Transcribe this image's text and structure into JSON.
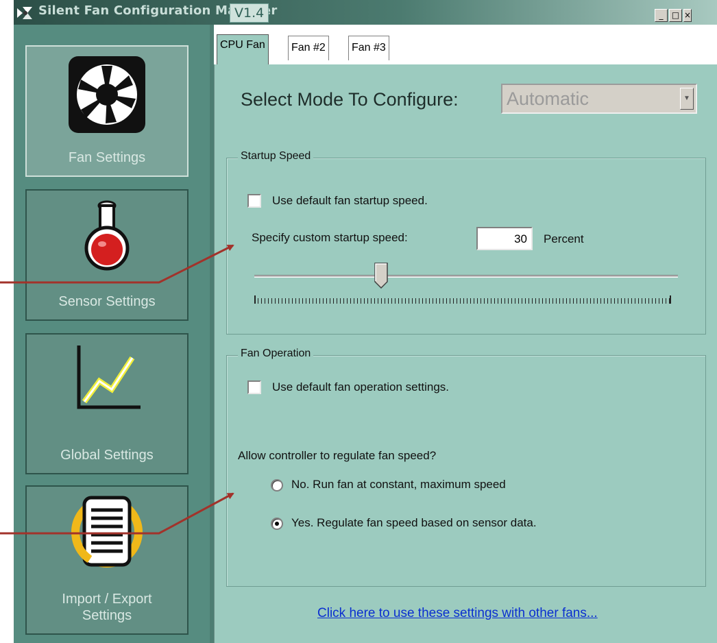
{
  "window": {
    "title": "Silent Fan Configuration Manager",
    "version": "V1.4",
    "minimize": "_",
    "maximize": "□",
    "close": "×"
  },
  "sidebar": {
    "items": [
      {
        "label": "Fan Settings",
        "icon": "fan-icon",
        "active": true
      },
      {
        "label": "Sensor Settings",
        "icon": "flask-icon",
        "active": false
      },
      {
        "label": "Global Settings",
        "icon": "line-chart-icon",
        "active": false
      },
      {
        "label": "Import / Export",
        "label2": "Settings",
        "icon": "document-sync-icon",
        "active": false
      }
    ]
  },
  "tabs": [
    {
      "label": "CPU Fan",
      "active": true
    },
    {
      "label": "Fan #2",
      "active": false
    },
    {
      "label": "Fan #3",
      "active": false
    }
  ],
  "mode": {
    "label": "Select Mode To Configure:",
    "value": "Automatic"
  },
  "startup": {
    "legend": "Startup Speed",
    "default_checkbox_label": "Use default fan startup speed.",
    "default_checked": false,
    "custom_label": "Specify custom startup speed:",
    "value": "30",
    "unit": "Percent",
    "slider_percent": 30
  },
  "operation": {
    "legend": "Fan Operation",
    "default_checkbox_label": "Use default fan operation settings.",
    "default_checked": false,
    "question": "Allow controller to regulate fan speed?",
    "options": [
      {
        "label": "No.  Run fan at constant, maximum speed",
        "selected": false
      },
      {
        "label": "Yes.  Regulate fan speed based on sensor data.",
        "selected": true
      }
    ]
  },
  "link": {
    "text": "Click here to use these settings with other fans..."
  },
  "colors": {
    "panel": "#9ccbbf",
    "sidebar": "#568c80",
    "annotation_arrow": "#a2322a",
    "link": "#0a2fd0"
  }
}
